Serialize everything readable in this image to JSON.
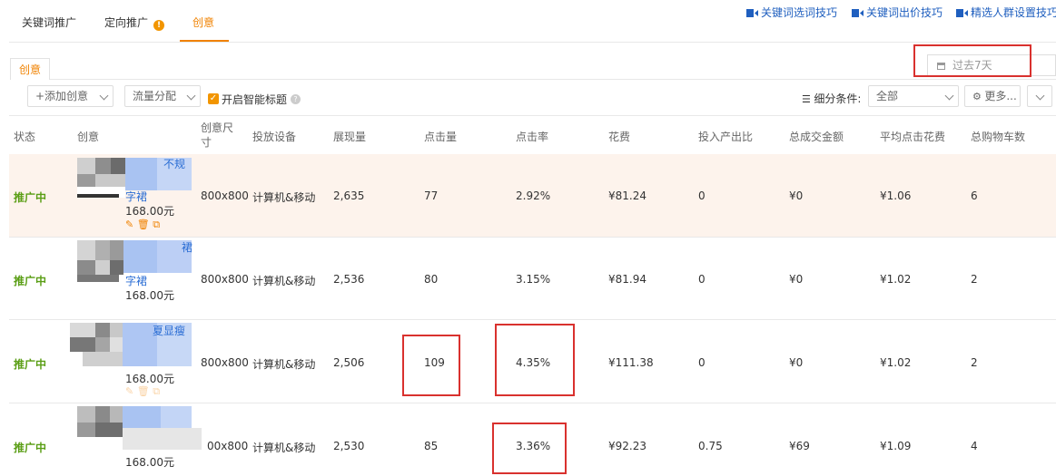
{
  "tabs": [
    {
      "label": "关键词推广",
      "active": false
    },
    {
      "label": "定向推广",
      "active": false,
      "warning": "!"
    },
    {
      "label": "创意",
      "active": true
    }
  ],
  "top_links": [
    "关键词选词技巧",
    "关键词出价技巧",
    "精选人群设置技巧"
  ],
  "subtab": "创意",
  "date_range": "过去7天",
  "toolbar": {
    "add_creative": "+添加创意",
    "traffic_split": "流量分配",
    "smart_title_label": "开启智能标题",
    "filter_label": "细分条件:",
    "filter_value": "全部",
    "more_label": "更多..."
  },
  "columns": [
    "状态",
    "创意",
    "创意尺寸",
    "投放设备",
    "展现量",
    "点击量",
    "点击率",
    "花费",
    "投入产出比",
    "总成交金额",
    "平均点击花费",
    "总购物车数"
  ],
  "rows": [
    {
      "status": "推广中",
      "title_top": "不规",
      "title_sub": "字裙",
      "price": "168.00元",
      "size": "800x800",
      "device": "计算机&移动",
      "impressions": "2,635",
      "clicks": "77",
      "ctr": "2.92%",
      "spend": "¥81.24",
      "roi": "0",
      "gmv": "¥0",
      "cpc": "¥1.06",
      "cart": "6"
    },
    {
      "status": "推广中",
      "title_top": "裙",
      "title_sub": "字裙",
      "price": "168.00元",
      "size": "800x800",
      "device": "计算机&移动",
      "impressions": "2,536",
      "clicks": "80",
      "ctr": "3.15%",
      "spend": "¥81.94",
      "roi": "0",
      "gmv": "¥0",
      "cpc": "¥1.02",
      "cart": "2"
    },
    {
      "status": "推广中",
      "title_top": "夏显瘦",
      "title_sub": "",
      "price": "168.00元",
      "size": "800x800",
      "device": "计算机&移动",
      "impressions": "2,506",
      "clicks": "109",
      "ctr": "4.35%",
      "spend": "¥111.38",
      "roi": "0",
      "gmv": "¥0",
      "cpc": "¥1.02",
      "cart": "2"
    },
    {
      "status": "推广中",
      "title_top": "",
      "title_sub": "",
      "price": "168.00元",
      "size": "00x800",
      "device": "计算机&移动",
      "impressions": "2,530",
      "clicks": "85",
      "ctr": "3.36%",
      "spend": "¥92.23",
      "roi": "0.75",
      "gmv": "¥69",
      "cpc": "¥1.09",
      "cart": "4"
    }
  ],
  "colors": {
    "accent": "#f08200",
    "status": "#5a9e15",
    "link": "#1f5fbf",
    "highlight_row": "#fdf3ec",
    "annotation": "#d9312e"
  }
}
